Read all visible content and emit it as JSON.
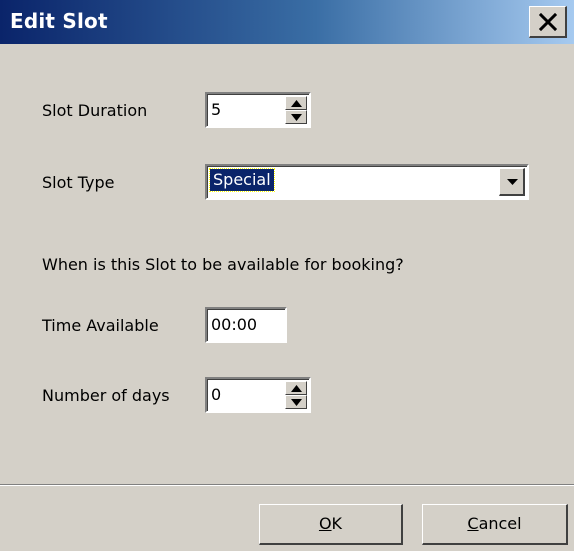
{
  "window": {
    "title": "Edit Slot"
  },
  "form": {
    "slot_duration": {
      "label": "Slot Duration",
      "value": "5"
    },
    "slot_type": {
      "label": "Slot Type",
      "value": "Special"
    },
    "availability_question": "When is this Slot to be available for booking?",
    "time_available": {
      "label": "Time Available",
      "value": "00:00"
    },
    "number_of_days": {
      "label": "Number of days",
      "value": "0"
    }
  },
  "buttons": {
    "ok": {
      "mnemonic": "O",
      "rest": "K"
    },
    "cancel": {
      "mnemonic": "C",
      "rest": "ancel"
    }
  },
  "icons": {
    "close": "close-icon",
    "spin_up": "triangle-up-icon",
    "spin_down": "triangle-down-icon",
    "dropdown": "chevron-down-icon"
  },
  "colors": {
    "title_bar_start": "#0a246a",
    "title_bar_end": "#a6caf0",
    "dialog_background": "#d4d0c8",
    "selection_background": "#0a246a"
  }
}
